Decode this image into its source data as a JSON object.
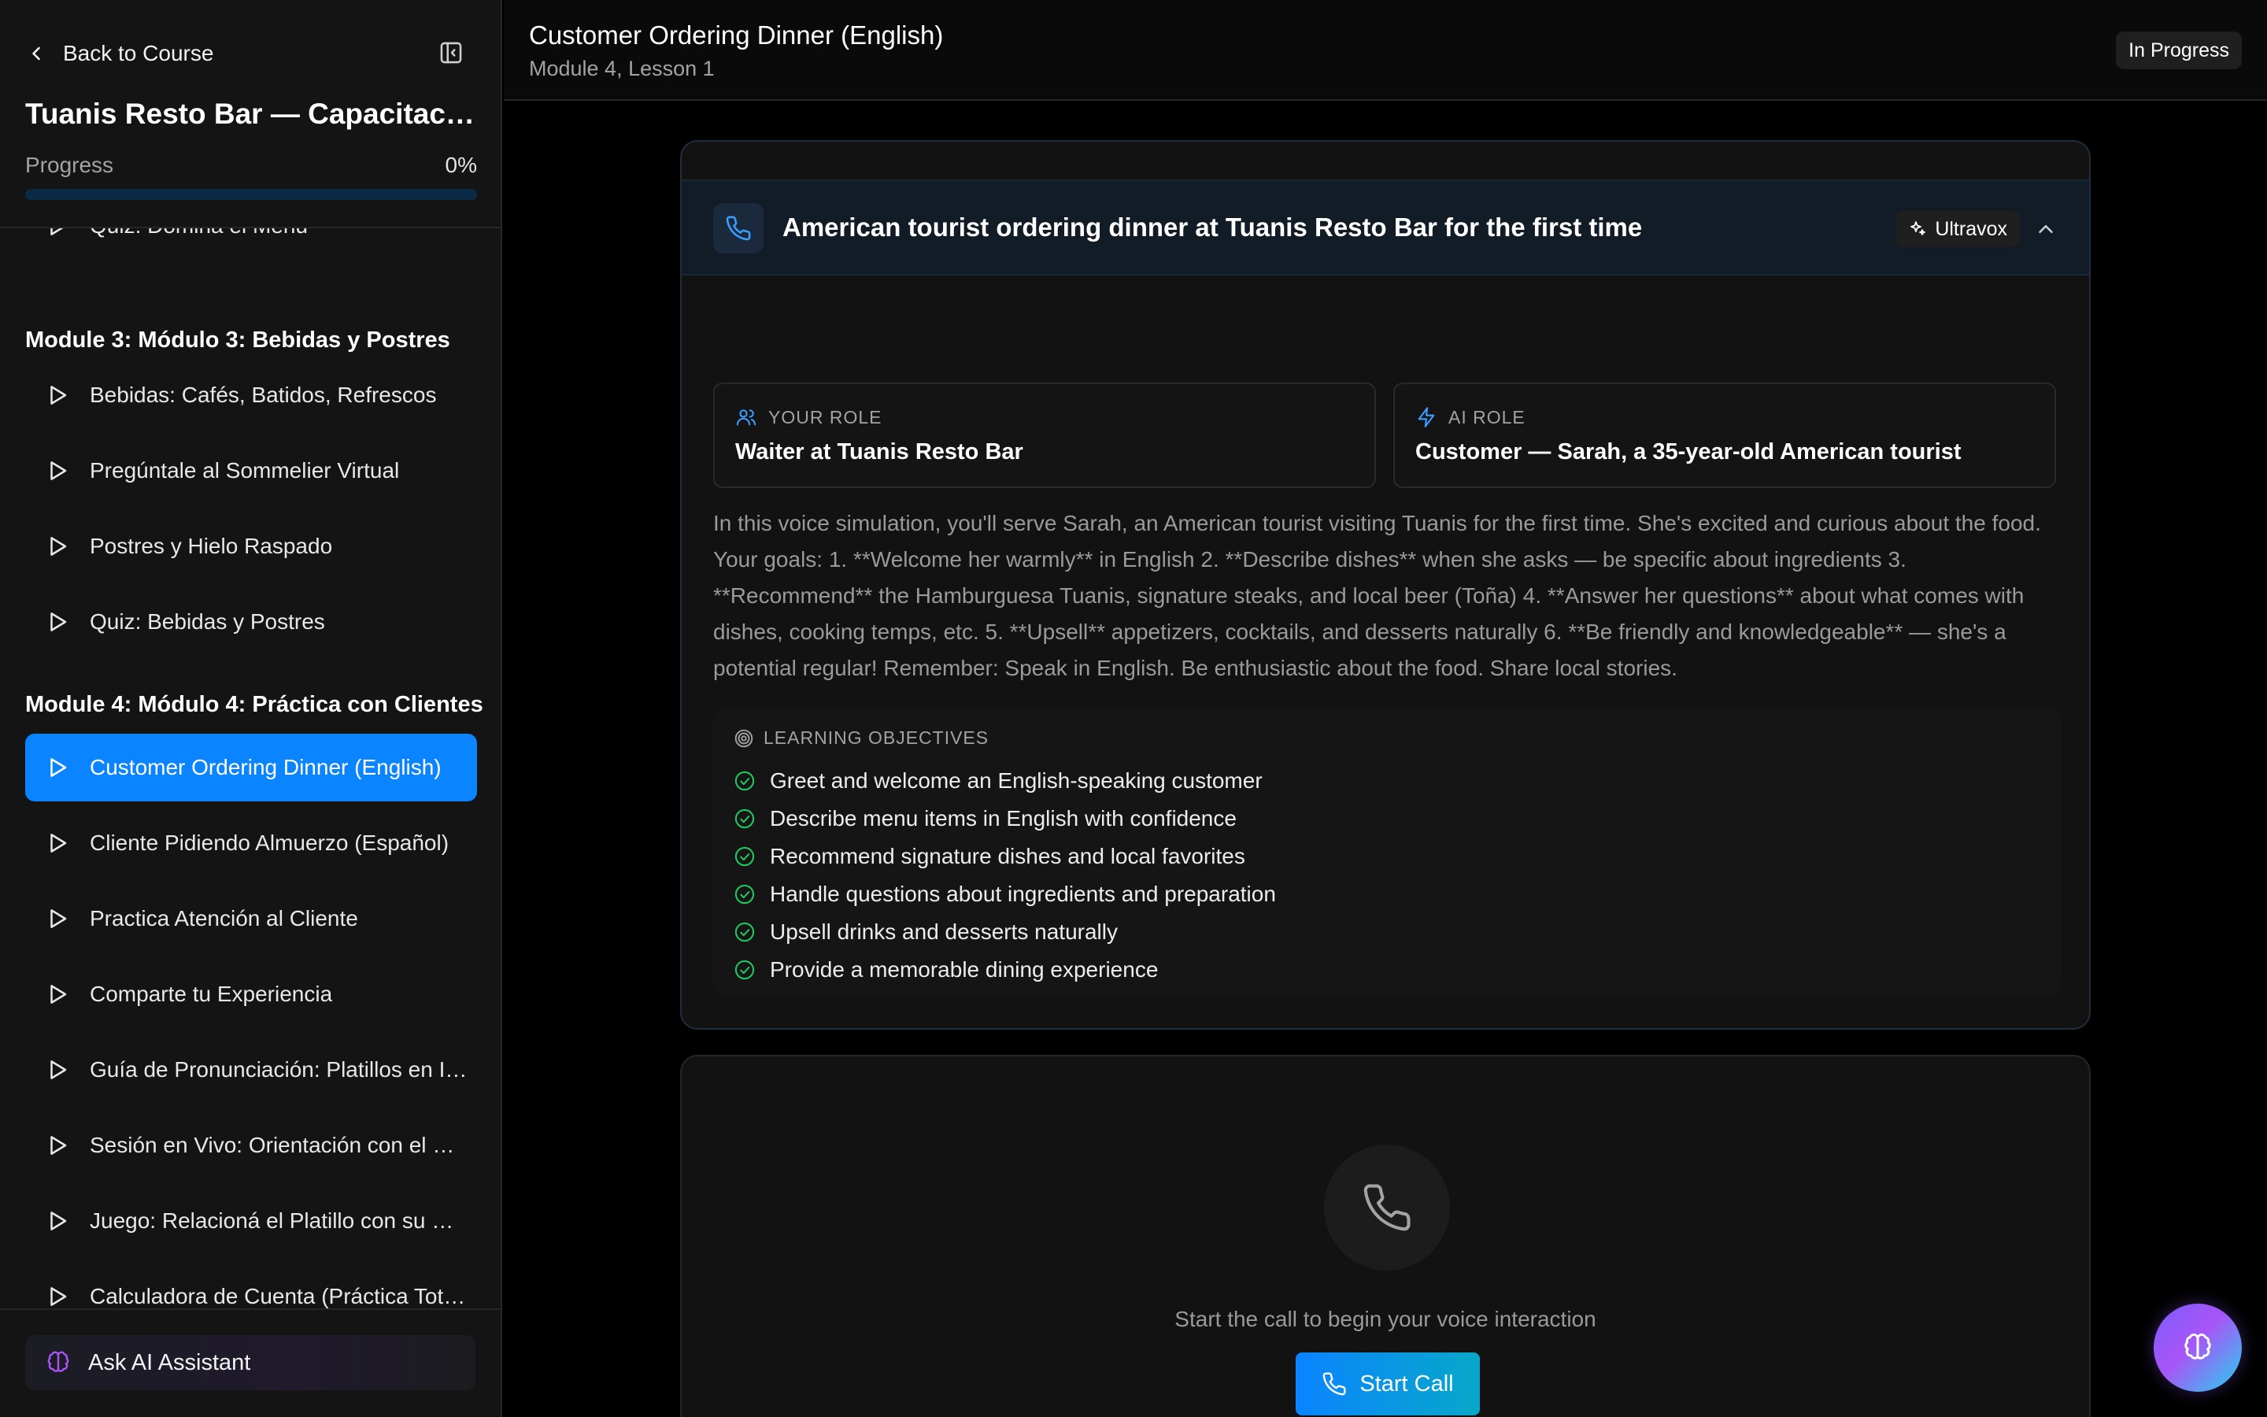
{
  "sidebar": {
    "back_label": "Back to Course",
    "course_title": "Tuanis Resto Bar — Capacitación",
    "progress_label": "Progress",
    "progress_value": "0%",
    "progress_fraction": 0,
    "items_before": [
      {
        "label": "Quiz: Domina el Menú"
      }
    ],
    "module3": {
      "title": "Module 3: Módulo 3: Bebidas y Postres",
      "items": [
        {
          "label": "Bebidas: Cafés, Batidos, Refrescos"
        },
        {
          "label": "Pregúntale al Sommelier Virtual"
        },
        {
          "label": "Postres y Hielo Raspado"
        },
        {
          "label": "Quiz: Bebidas y Postres"
        }
      ]
    },
    "module4": {
      "title": "Module 4: Módulo 4: Práctica con Clientes",
      "items": [
        {
          "label": "Customer Ordering Dinner (English)",
          "active": true
        },
        {
          "label": "Cliente Pidiendo Almuerzo (Español)"
        },
        {
          "label": "Practica Atención al Cliente"
        },
        {
          "label": "Comparte tu Experiencia"
        },
        {
          "label": "Guía de Pronunciación: Platillos en Inglés"
        },
        {
          "label": "Sesión en Vivo: Orientación con el Chef"
        },
        {
          "label": "Juego: Relacioná el Platillo con su Nombre"
        },
        {
          "label": "Calculadora de Cuenta (Práctica Total)"
        }
      ]
    },
    "ai_assistant_label": "Ask AI Assistant"
  },
  "header": {
    "title": "Customer Ordering Dinner (English)",
    "subtitle": "Module 4, Lesson 1",
    "status": "In Progress"
  },
  "simulation": {
    "title": "American tourist ordering dinner at Tuanis Resto Bar for the first time",
    "provider": "Ultravox",
    "your_role_label": "YOUR ROLE",
    "your_role": "Waiter at Tuanis Resto Bar",
    "ai_role_label": "AI ROLE",
    "ai_role": "Customer — Sarah, a 35-year-old American tourist",
    "description": "In this voice simulation, you'll serve Sarah, an American tourist visiting Tuanis for the first time. She's excited and curious about the food. Your goals: 1. **Welcome her warmly** in English 2. **Describe dishes** when she asks — be specific about ingredients 3. **Recommend** the Hamburguesa Tuanis, signature steaks, and local beer (Toña) 4. **Answer her questions** about what comes with dishes, cooking temps, etc. 5. **Upsell** appetizers, cocktails, and desserts naturally 6. **Be friendly and knowledgeable** — she's a potential regular! Remember: Speak in English. Be enthusiastic about the food. Share local stories.",
    "objectives_label": "LEARNING OBJECTIVES",
    "objectives": [
      "Greet and welcome an English-speaking customer",
      "Describe menu items in English with confidence",
      "Recommend signature dishes and local favorites",
      "Handle questions about ingredients and preparation",
      "Upsell drinks and desserts naturally",
      "Provide a memorable dining experience"
    ]
  },
  "call": {
    "hint": "Start the call to begin your voice interaction",
    "button_label": "Start Call"
  },
  "colors": {
    "accent": "#0a84ff",
    "success": "#22c55e",
    "ai_purple": "#a855f7"
  }
}
